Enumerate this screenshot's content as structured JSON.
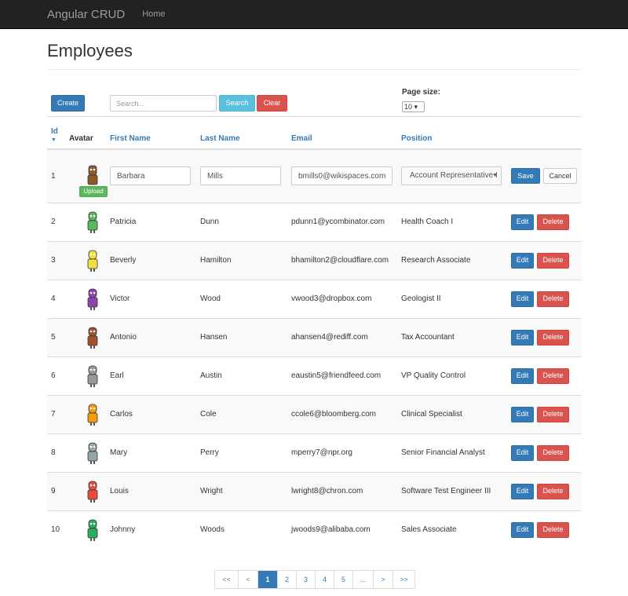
{
  "navbar": {
    "brand": "Angular CRUD",
    "home": "Home"
  },
  "page": {
    "title": "Employees"
  },
  "toolbar": {
    "create_label": "Create",
    "search_placeholder": "Search...",
    "search_label": "Search",
    "clear_label": "Clear",
    "page_size_label": "Page size:",
    "page_size_value": "10"
  },
  "columns": {
    "id": "Id",
    "avatar": "Avatar",
    "first_name": "First Name",
    "last_name": "Last Name",
    "email": "Email",
    "position": "Position"
  },
  "edit_row": {
    "id": "1",
    "first_name": "Barbara",
    "last_name": "Mills",
    "email": "bmills0@wikispaces.com",
    "position": "Account Representative I",
    "upload_label": "Upload",
    "save_label": "Save",
    "cancel_label": "Cancel",
    "avatar_color": "#8b5a2b"
  },
  "rows": [
    {
      "id": "2",
      "first_name": "Patricia",
      "last_name": "Dunn",
      "email": "pdunn1@ycombinator.com",
      "position": "Health Coach I",
      "avatar_color": "#5cb85c"
    },
    {
      "id": "3",
      "first_name": "Beverly",
      "last_name": "Hamilton",
      "email": "bhamilton2@cloudflare.com",
      "position": "Research Associate",
      "avatar_color": "#f0e040"
    },
    {
      "id": "4",
      "first_name": "Victor",
      "last_name": "Wood",
      "email": "vwood3@dropbox.com",
      "position": "Geologist II",
      "avatar_color": "#8e44ad"
    },
    {
      "id": "5",
      "first_name": "Antonio",
      "last_name": "Hansen",
      "email": "ahansen4@rediff.com",
      "position": "Tax Accountant",
      "avatar_color": "#a0522d"
    },
    {
      "id": "6",
      "first_name": "Earl",
      "last_name": "Austin",
      "email": "eaustin5@friendfeed.com",
      "position": "VP Quality Control",
      "avatar_color": "#999999"
    },
    {
      "id": "7",
      "first_name": "Carlos",
      "last_name": "Cole",
      "email": "ccole6@bloomberg.com",
      "position": "Clinical Specialist",
      "avatar_color": "#f39c12"
    },
    {
      "id": "8",
      "first_name": "Mary",
      "last_name": "Perry",
      "email": "mperry7@npr.org",
      "position": "Senior Financial Analyst",
      "avatar_color": "#95a5a6"
    },
    {
      "id": "9",
      "first_name": "Louis",
      "last_name": "Wright",
      "email": "lwright8@chron.com",
      "position": "Software Test Engineer III",
      "avatar_color": "#e74c3c"
    },
    {
      "id": "10",
      "first_name": "Johnny",
      "last_name": "Woods",
      "email": "jwoods9@alibaba.com",
      "position": "Sales Associate",
      "avatar_color": "#27ae60"
    }
  ],
  "row_actions": {
    "edit_label": "Edit",
    "delete_label": "Delete"
  },
  "pagination": {
    "first": "<<",
    "prev": "<",
    "pages": [
      "1",
      "2",
      "3",
      "4",
      "5"
    ],
    "ellipsis": "...",
    "next": ">",
    "last": ">>",
    "current": "1"
  },
  "colors": {
    "navbar": "#222222",
    "primary": "#337ab7",
    "danger": "#d9534f",
    "info": "#5bc0de",
    "success": "#5cb85c"
  }
}
